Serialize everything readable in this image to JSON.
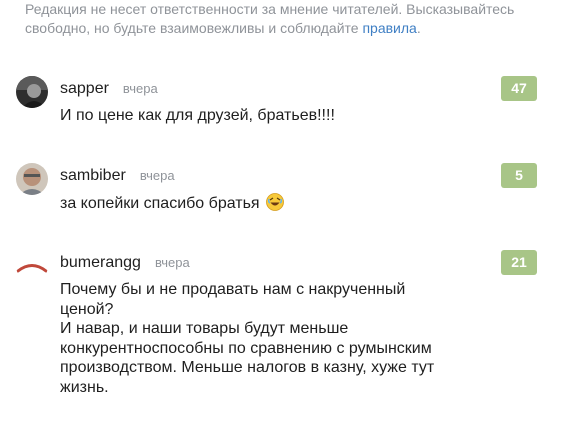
{
  "disclaimer": {
    "text": "Редакция не несет ответственности за мнение читателей. Высказывайтесь свободно, но будьте взаимовежливы и соблюдайте ",
    "link": "правила",
    "end": "."
  },
  "comments": [
    {
      "author": "sapper",
      "time": "вчера",
      "rating": "47",
      "text": "И по цене как для друзей, братьев!!!!"
    },
    {
      "author": "sambiber",
      "time": "вчера",
      "rating": "5",
      "text": "за копейки спасибо братья",
      "emoji": "rofl-emoji-icon"
    },
    {
      "author": "bumerangg",
      "time": "вчера",
      "rating": "21",
      "text": "Почему бы и не продавать нам с накрученный ценой?\nИ навар, и наши товары будут меньше конкурентноспособны по сравнению с румынским производством. Меньше налогов в казну, хуже тут жизнь."
    }
  ],
  "colors": {
    "rating_bg": "#a8c587",
    "muted_text": "#8f9399",
    "link": "#3f7fc4"
  }
}
